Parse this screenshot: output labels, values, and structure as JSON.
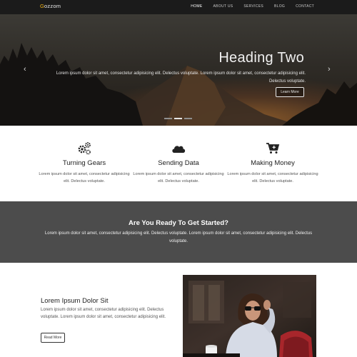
{
  "navbar": {
    "brand": "Gozzom",
    "items": [
      {
        "label": "Home",
        "active": true
      },
      {
        "label": "About Us",
        "active": false
      },
      {
        "label": "Services",
        "active": false
      },
      {
        "label": "Blog",
        "active": false
      },
      {
        "label": "Contact",
        "active": false
      }
    ]
  },
  "hero": {
    "heading": "Heading Two",
    "text": "Lorem ipsum dolor sit amet, consectetur adipisicing elit. Delectus voluptate. Lorem ipsum dolor sit amet, consectetur adipisicing elit. Delectus voluptate.",
    "button": "Learn More",
    "prev_icon": "chevron-left-icon",
    "next_icon": "chevron-right-icon",
    "slide_count": 3,
    "active_slide": 2
  },
  "features": [
    {
      "icon": "gears-icon",
      "title": "Turning Gears",
      "text": "Lorem ipsum dolor sit amet, consectetur adipisicing elit. Delectus voluptate."
    },
    {
      "icon": "cloud-icon",
      "title": "Sending Data",
      "text": "Lorem ipsum dolor sit amet, consectetur adipisicing elit. Delectus voluptate."
    },
    {
      "icon": "cart-icon",
      "title": "Making Money",
      "text": "Lorem ipsum dolor sit amet, consectetur adipisicing elit. Delectus voluptate."
    }
  ],
  "cta": {
    "title": "Are You Ready To Get Started?",
    "text": "Lorem ipsum dolor sit amet, consectetur adipisicing elit. Delectus voluptate. Lorem ipsum dolor sit amet, consectetur adipisicing elit. Delectus voluptate."
  },
  "about": {
    "title": "Lorem Ipsum Dolor Sit",
    "text": "Lorem ipsum dolor sit amet, consectetur adipisicing elit. Delectus voluptate. Lorem ipsum dolor sit amet, consectetur adipisicing elit.",
    "button": "Read More"
  },
  "colors": {
    "navbar": "#1b1b1b",
    "brand_accent": "#f3b417",
    "cta_band": "#4c4c4c"
  }
}
